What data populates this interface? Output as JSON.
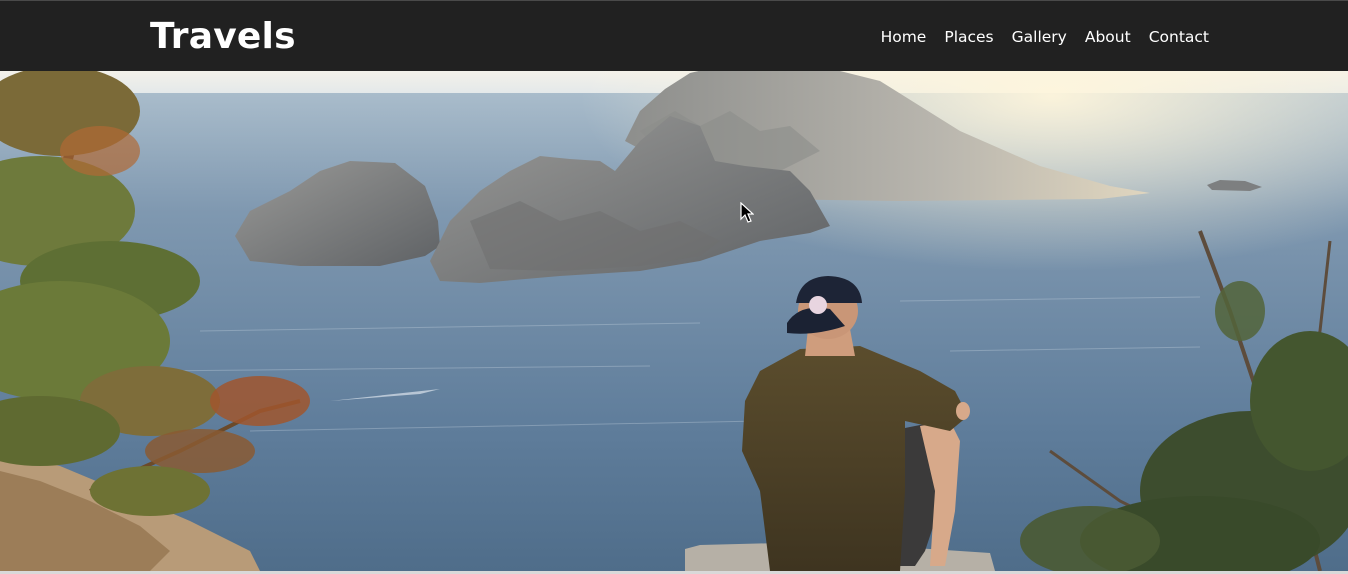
{
  "brand": {
    "title": "Travels"
  },
  "nav": {
    "items": [
      {
        "label": "Home"
      },
      {
        "label": "Places"
      },
      {
        "label": "Gallery"
      },
      {
        "label": "About"
      },
      {
        "label": "Contact"
      }
    ]
  },
  "hero": {
    "image": "cliff-sea-islands-man-with-cap"
  },
  "colors": {
    "navbar_bg": "#212121",
    "nav_text": "#ffffff",
    "sea": "#5f7f9e",
    "sky": "#eef0ee"
  }
}
